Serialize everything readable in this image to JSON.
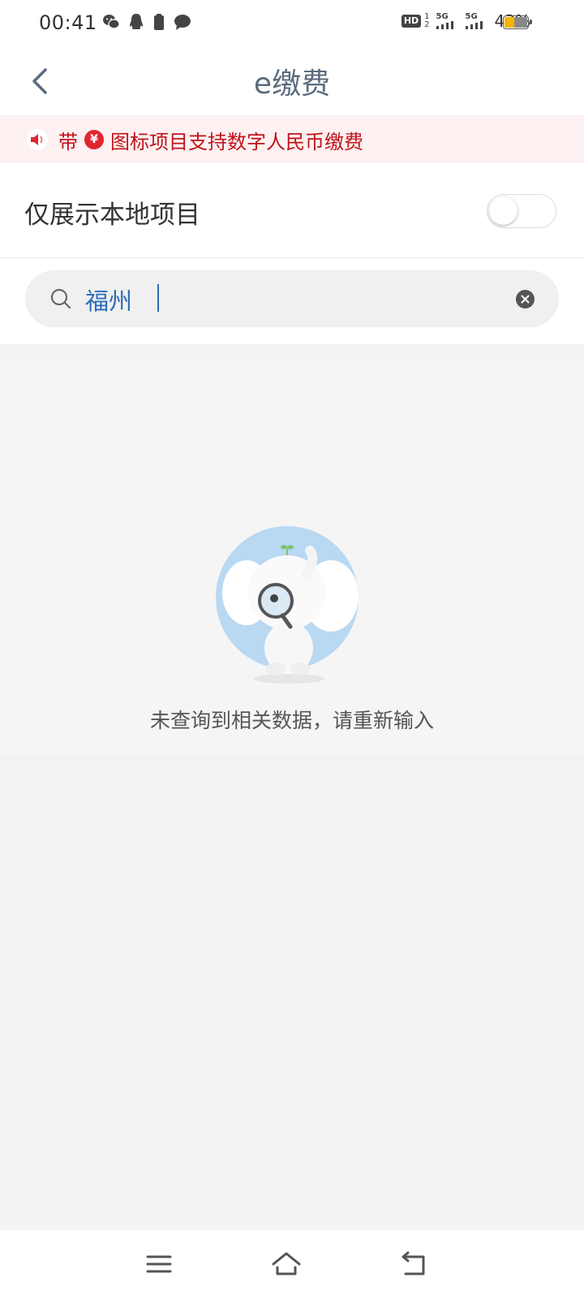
{
  "status_bar": {
    "time": "00:41",
    "hd_label": "HD",
    "hd_sup_top": "1",
    "hd_sup_bottom": "2",
    "signal1_label": "5G",
    "signal2_label": "5G",
    "battery_text": "43%",
    "battery_level": 0.43,
    "battery_color": "#f5b400",
    "left_icons": [
      "wechat-icon",
      "qq-icon",
      "battery-saver-icon",
      "message-icon"
    ]
  },
  "header": {
    "title": "e缴费",
    "back_icon": "chevron-left-icon"
  },
  "notice": {
    "prefix": "带",
    "currency_symbol": "¥",
    "text": "图标项目支持数字人民币缴费",
    "text_color": "#c0141c"
  },
  "local_filter": {
    "label": "仅展示本地项目",
    "enabled": false
  },
  "search": {
    "value": "福州",
    "value_color": "#2c6bb8"
  },
  "empty_state": {
    "message": "未查询到相关数据，请重新输入",
    "illustration": "elephant-magnifier-illustration"
  },
  "bottom_nav": {
    "icons": [
      "menu-icon",
      "home-icon",
      "back-icon"
    ]
  }
}
